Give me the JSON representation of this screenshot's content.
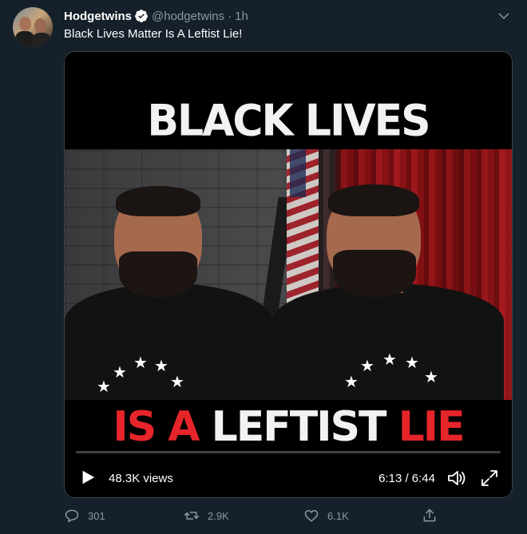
{
  "tweet": {
    "author_name": "Hodgetwins",
    "handle": "@hodgetwins",
    "separator": "·",
    "time": "1h",
    "text": "Black Lives Matter Is A Leftist Lie!",
    "verified_icon": "verified-badge-icon",
    "menu_icon": "chevron-down-icon"
  },
  "video": {
    "caption_top": "BLACK LIVES MATTER",
    "caption_bottom_1": "IS A",
    "caption_bottom_2": "LEFTIST",
    "caption_bottom_3": "LIE",
    "views": "48.3K views",
    "timecode": "6:13 / 6:44",
    "progress": 0.0,
    "play_icon": "play-icon",
    "volume_icon": "volume-icon",
    "fullscreen_icon": "fullscreen-icon"
  },
  "actions": {
    "reply_count": "301",
    "retweet_count": "2.9K",
    "like_count": "6.1K",
    "reply_icon": "reply-icon",
    "retweet_icon": "retweet-icon",
    "like_icon": "heart-icon",
    "share_icon": "share-icon"
  },
  "colors": {
    "background": "#15202b",
    "secondary_text": "#8899a6",
    "accent": "#1da1f2",
    "caption_red": "#e5252a"
  }
}
